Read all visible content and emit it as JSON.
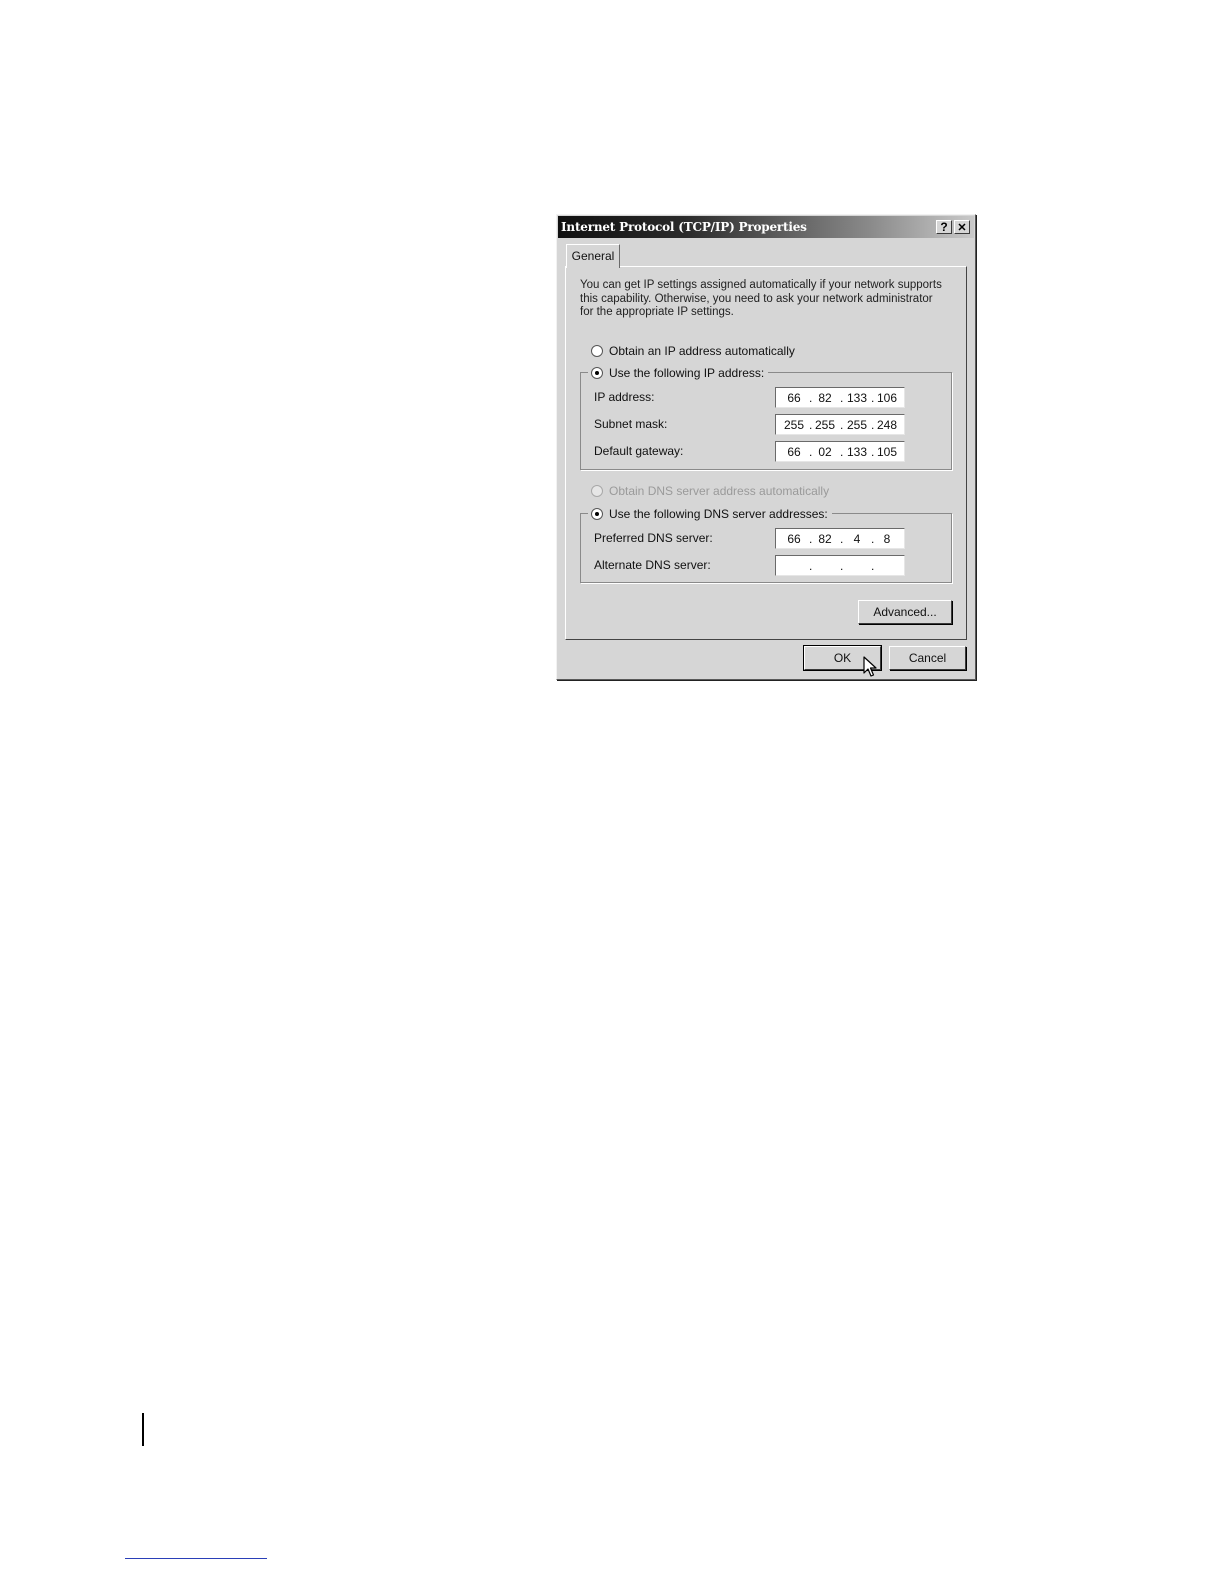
{
  "dialog": {
    "title": "Internet Protocol (TCP/IP) Properties",
    "help_label": "?",
    "close_label": "✕"
  },
  "tabs": [
    {
      "label": "General",
      "selected": true
    }
  ],
  "intro_text": "You can get IP settings assigned automatically if your network supports this capability. Otherwise, you need to ask your network administrator for the appropriate IP settings.",
  "ip_settings": {
    "auto_label": "Obtain an IP address automatically",
    "auto_selected": false,
    "manual_label": "Use the following IP address:",
    "manual_selected": true,
    "fields": [
      {
        "label": "IP address:",
        "octets": [
          "66",
          "82",
          "133",
          "106"
        ]
      },
      {
        "label": "Subnet mask:",
        "octets": [
          "255",
          "255",
          "255",
          "248"
        ]
      },
      {
        "label": "Default gateway:",
        "octets": [
          "66",
          "02",
          "133",
          "105"
        ]
      }
    ]
  },
  "dns_settings": {
    "auto_label": "Obtain DNS server address automatically",
    "auto_enabled": false,
    "manual_label": "Use the following DNS server addresses:",
    "manual_selected": true,
    "fields": [
      {
        "label": "Preferred DNS server:",
        "octets": [
          "66",
          "82",
          "4",
          "8"
        ]
      },
      {
        "label": "Alternate DNS server:",
        "octets": [
          "",
          "",
          "",
          ""
        ]
      }
    ]
  },
  "buttons": {
    "advanced": "Advanced...",
    "ok": "OK",
    "cancel": "Cancel"
  },
  "icons": {
    "cursor": "arrow-pointer-icon"
  },
  "colors": {
    "dialog_face": "#d6d6d6",
    "title_start": "#101010",
    "title_end": "#c9c9c9",
    "page_link_line": "#2a3fb8"
  }
}
